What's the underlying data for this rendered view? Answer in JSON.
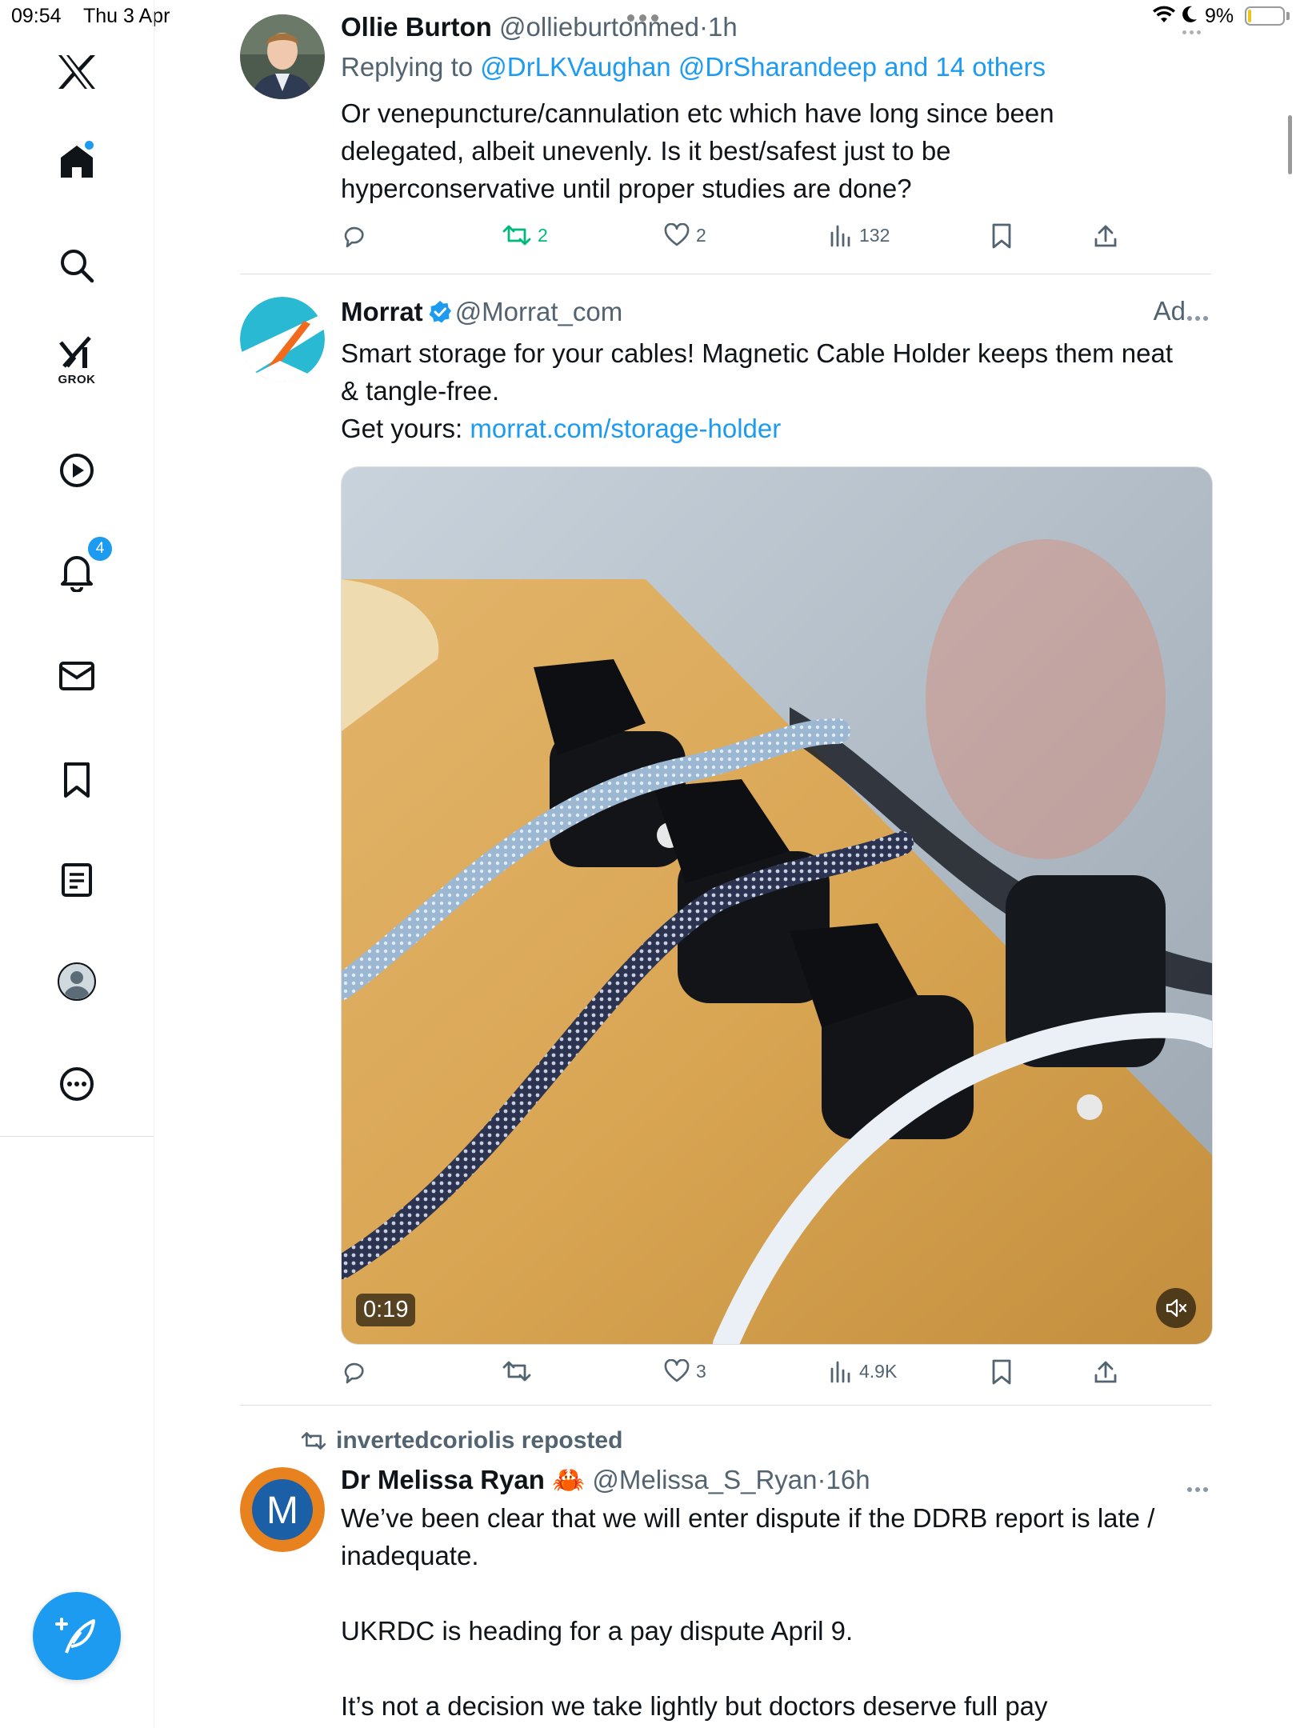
{
  "status_bar": {
    "time": "09:54",
    "date": "Thu 3 Apr",
    "battery_pct": "9%",
    "battery_level": 0.09
  },
  "sidebar": {
    "badge_count": "4",
    "grok_label": "GROK",
    "items": [
      "x-logo",
      "home-icon",
      "search-icon",
      "grok-icon",
      "video-icon",
      "bell-icon",
      "mail-icon",
      "bookmark-icon",
      "lists-icon",
      "profile-icon",
      "more-icon"
    ]
  },
  "tweets": [
    {
      "name": "Ollie Burton",
      "handle": "@ollieburtonmed",
      "sep": "·",
      "time": "1h",
      "replying_prefix": "Replying to",
      "replying_handles": "@DrLKVaughan @DrSharandeep and 14 others",
      "text_lines": [
        "Or venepuncture/cannulation etc which have long since been",
        "delegated, albeit unevenly. Is it best/safest just to be",
        "hyperconservative until proper studies are done?"
      ],
      "reposts": "2",
      "likes": "2",
      "views": "132"
    },
    {
      "name": "Morrat",
      "handle": "@Morrat_com",
      "ad_label": "Ad",
      "text_lines": [
        "Smart storage for your cables! Magnetic Cable Holder keeps them neat",
        "& tangle-free."
      ],
      "cta_prefix": "Get yours:",
      "cta_link": "morrat.com/storage-holder",
      "video_duration": "0:19",
      "likes": "3",
      "views": "4.9K"
    },
    {
      "repost_by": "invertedcoriolis reposted",
      "name": "Dr Melissa Ryan",
      "emoji": "🦀",
      "handle": "@Melissa_S_Ryan",
      "sep": "·",
      "time": "16h",
      "avatar_letter": "M",
      "text_lines": [
        "We’ve been clear that we will enter dispute if the DDRB report is late  /",
        "inadequate.",
        "",
        "UKRDC is heading for a pay dispute April 9.",
        "",
        "It’s not a decision we take lightly but doctors deserve full pay"
      ]
    }
  ],
  "colors": {
    "accent": "#1d9bf0",
    "repost_green": "#00ba7c",
    "secondary_text": "#536471"
  }
}
